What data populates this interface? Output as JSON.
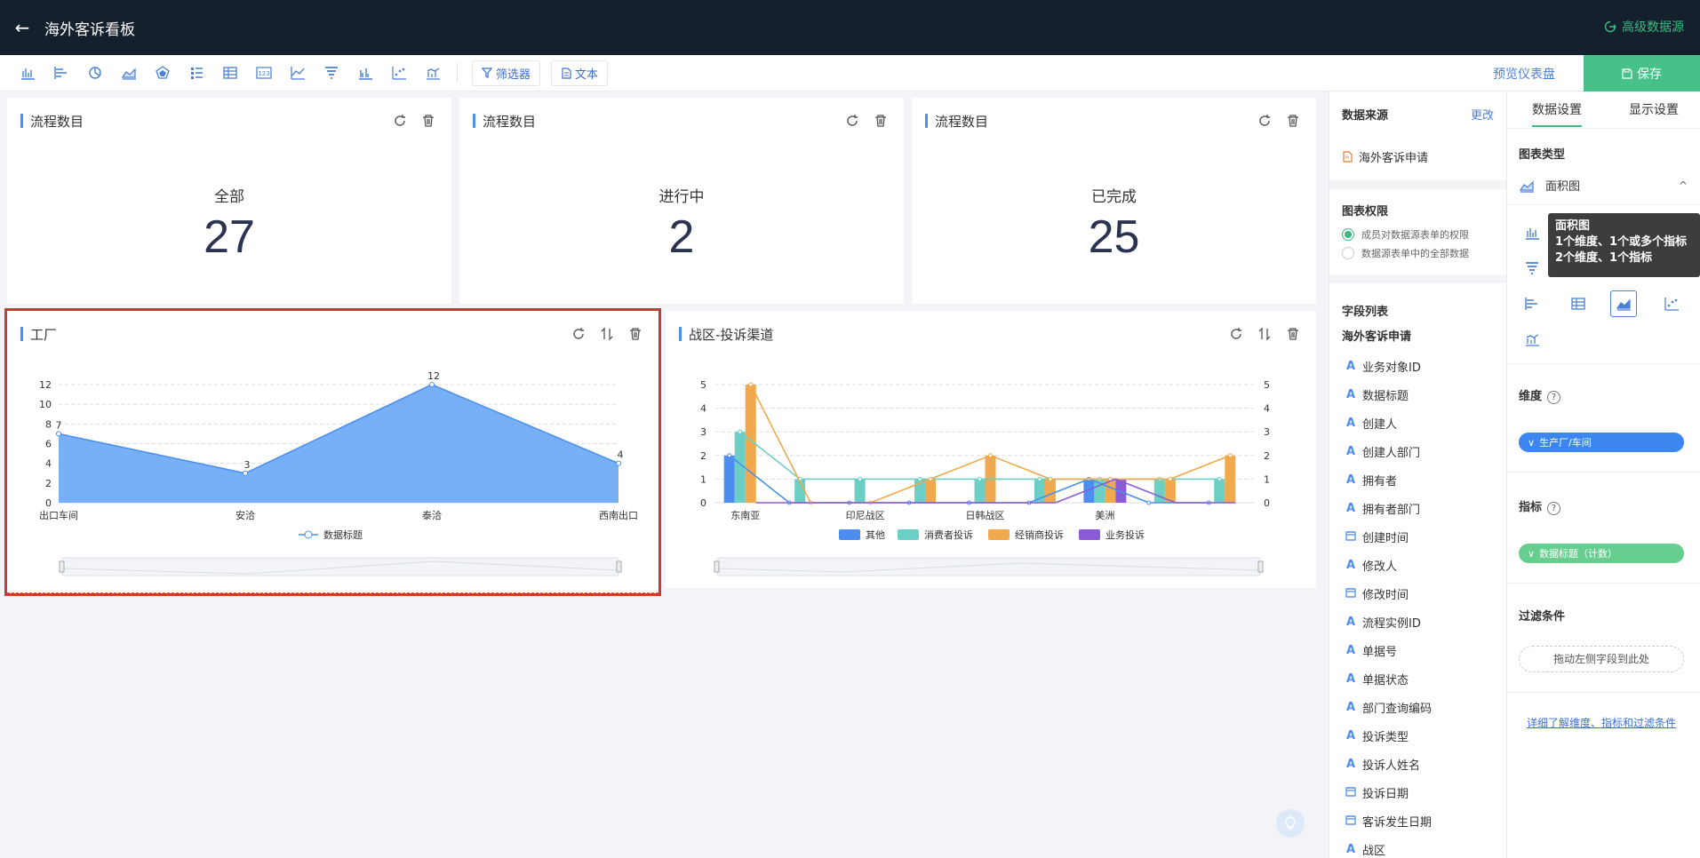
{
  "header": {
    "title": "海外客诉看板",
    "advanced_source": "高级数据源"
  },
  "toolbar": {
    "filter_label": "筛选器",
    "text_label": "文本",
    "preview_label": "预览仪表盘",
    "save_label": "保存"
  },
  "metrics": [
    {
      "title": "流程数目",
      "label": "全部",
      "value": "27"
    },
    {
      "title": "流程数目",
      "label": "进行中",
      "value": "2"
    },
    {
      "title": "流程数目",
      "label": "已完成",
      "value": "25"
    }
  ],
  "chart_factory": {
    "title": "工厂"
  },
  "chart_region": {
    "title": "战区-投诉渠道"
  },
  "chart_data": [
    {
      "type": "area",
      "categories": [
        "出口车间",
        "安洽",
        "泰洽",
        "西南出口"
      ],
      "series": [
        {
          "name": "数据标题",
          "values": [
            7,
            3,
            12,
            4
          ]
        }
      ],
      "ylim": [
        0,
        12
      ],
      "yticks": [
        "0",
        "2",
        "4",
        "6",
        "8",
        "10",
        "12"
      ],
      "data_labels": [
        "7",
        "3",
        "12",
        "4"
      ]
    },
    {
      "type": "bar",
      "categories_labeled": [
        "东南亚",
        "印尼战区",
        "日韩战区",
        "美洲"
      ],
      "groups": 9,
      "ylim": [
        0,
        5
      ],
      "yticks": [
        "0",
        "1",
        "2",
        "3",
        "4",
        "5"
      ],
      "series": [
        {
          "name": "其他",
          "color": "#4b8ef0",
          "values": [
            2,
            0,
            0,
            0,
            0,
            0,
            1,
            0,
            0
          ]
        },
        {
          "name": "消费者投诉",
          "color": "#6ccfc6",
          "values": [
            3,
            1,
            1,
            1,
            1,
            1,
            1,
            1,
            1
          ]
        },
        {
          "name": "经销商投诉",
          "color": "#f0a94c",
          "values": [
            5,
            0,
            0,
            1,
            2,
            1,
            1,
            1,
            2
          ]
        },
        {
          "name": "业务投诉",
          "color": "#8a5bd6",
          "values": [
            0,
            0,
            0,
            0,
            0,
            0,
            1,
            0,
            0
          ]
        }
      ]
    }
  ],
  "datasource": {
    "label": "数据来源",
    "change": "更改",
    "name": "海外客诉申请"
  },
  "permission": {
    "label": "图表权限",
    "opt1": "成员对数据源表单的权限",
    "opt2": "数据源表单中的全部数据"
  },
  "fields": {
    "label": "字段列表",
    "group": "海外客诉申请",
    "items": [
      {
        "icon": "A",
        "name": "业务对象ID"
      },
      {
        "icon": "A",
        "name": "数据标题"
      },
      {
        "icon": "A",
        "name": "创建人"
      },
      {
        "icon": "A",
        "name": "创建人部门"
      },
      {
        "icon": "A",
        "name": "拥有者"
      },
      {
        "icon": "A",
        "name": "拥有者部门"
      },
      {
        "icon": "cal",
        "name": "创建时间"
      },
      {
        "icon": "A",
        "name": "修改人"
      },
      {
        "icon": "cal",
        "name": "修改时间"
      },
      {
        "icon": "A",
        "name": "流程实例ID"
      },
      {
        "icon": "A",
        "name": "单据号"
      },
      {
        "icon": "A",
        "name": "单据状态"
      },
      {
        "icon": "A",
        "name": "部门查询编码"
      },
      {
        "icon": "A",
        "name": "投诉类型"
      },
      {
        "icon": "A",
        "name": "投诉人姓名"
      },
      {
        "icon": "cal",
        "name": "投诉日期"
      },
      {
        "icon": "cal",
        "name": "客诉发生日期"
      },
      {
        "icon": "A",
        "name": "战区"
      }
    ]
  },
  "settings": {
    "tab_data": "数据设置",
    "tab_display": "显示设置",
    "chart_type_label": "图表类型",
    "chart_type_value": "面积图",
    "dimension_label": "维度",
    "dimension_value": "生产厂/车间",
    "measure_label": "指标",
    "measure_value": "数据标题（计数）",
    "filter_label": "过滤条件",
    "dropzone": "拖动左侧字段到此处",
    "learn_more": "详细了解维度、指标和过滤条件"
  },
  "tooltip": {
    "line1": "面积图",
    "line2": "1个维度、1个或多个指标",
    "line3": "2个维度、1个指标"
  },
  "colors": {
    "accent": "#3fb883",
    "header_bg": "#14202c",
    "area": "#5fa2f5"
  }
}
